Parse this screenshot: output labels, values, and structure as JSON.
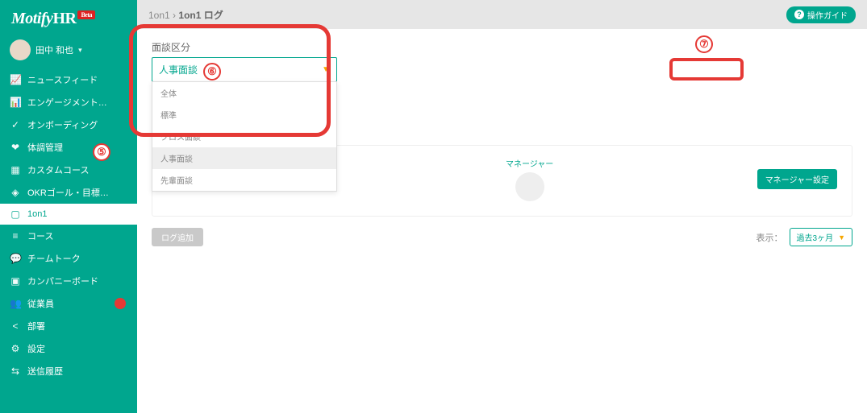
{
  "brand": {
    "name": "Motify",
    "suffix": "HR",
    "badge": "Beta"
  },
  "user": {
    "name": "田中 和也"
  },
  "sidebar": {
    "items": [
      {
        "icon": "📈",
        "label": "ニュースフィード"
      },
      {
        "icon": "📊",
        "label": "エンゲージメント…"
      },
      {
        "icon": "✓",
        "label": "オンボーディング"
      },
      {
        "icon": "❤",
        "label": "体調管理"
      },
      {
        "icon": "▦",
        "label": "カスタムコース"
      },
      {
        "icon": "◈",
        "label": "OKRゴール・目標…"
      },
      {
        "icon": "▢",
        "label": "1on1",
        "active": true
      },
      {
        "icon": "≡",
        "label": "コース"
      },
      {
        "icon": "💬",
        "label": "チームトーク"
      },
      {
        "icon": "▣",
        "label": "カンパニーボード"
      },
      {
        "icon": "👥",
        "label": "従業員",
        "badge": " "
      },
      {
        "icon": "<",
        "label": "部署"
      },
      {
        "icon": "⚙",
        "label": "設定"
      },
      {
        "icon": "⇆",
        "label": "送信履歴"
      }
    ]
  },
  "breadcrumb": {
    "parent": "1on1",
    "sep": "›",
    "current": "1on1 ログ"
  },
  "guide_button": "操作ガイド",
  "section": {
    "label": "面談区分",
    "selected": "人事面談",
    "options": [
      "全体",
      "標準",
      "クロス面談",
      "人事面談",
      "先輩面談"
    ]
  },
  "card": {
    "manager_label": "マネージャー",
    "manager_set_btn": "マネージャー設定"
  },
  "row2": {
    "log_add": "ログ追加",
    "display_label": "表示：",
    "period": "過去3ヶ月"
  },
  "annotations": {
    "a5": "⑤",
    "a6": "⑥",
    "a7": "⑦"
  }
}
